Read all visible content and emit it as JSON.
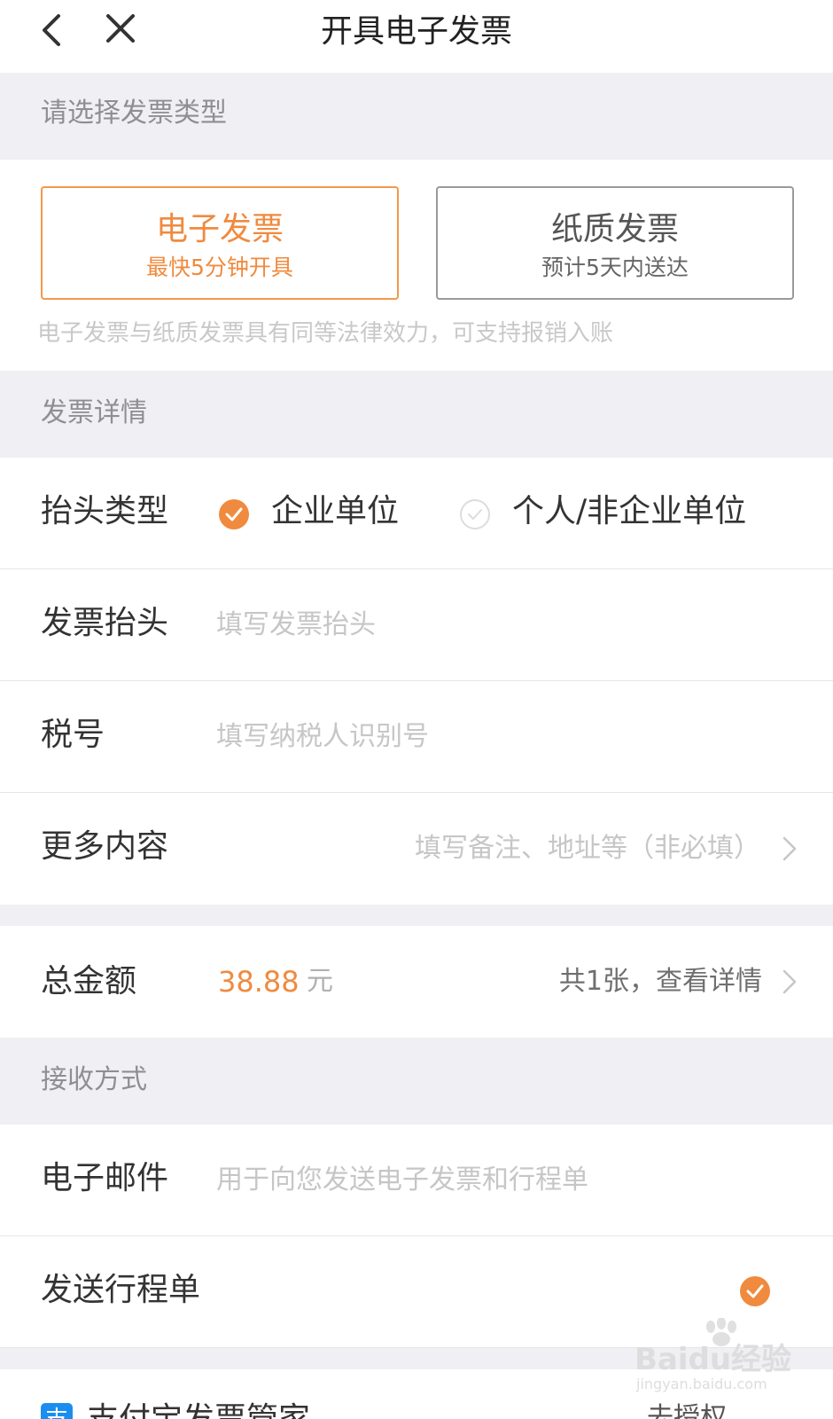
{
  "nav": {
    "title": "开具电子发票"
  },
  "section_type": {
    "header": "请选择发票类型",
    "options": [
      {
        "title": "电子发票",
        "subtitle": "最快5分钟开具",
        "selected": true
      },
      {
        "title": "纸质发票",
        "subtitle": "预计5天内送达",
        "selected": false
      }
    ],
    "note": "电子发票与纸质发票具有同等法律效力，可支持报销入账"
  },
  "section_detail": {
    "header": "发票详情",
    "title_type": {
      "label": "抬头类型",
      "options": [
        {
          "label": "企业单位",
          "checked": true
        },
        {
          "label": "个人/非企业单位",
          "checked": false
        }
      ]
    },
    "invoice_title": {
      "label": "发票抬头",
      "placeholder": "填写发票抬头"
    },
    "tax_number": {
      "label": "税号",
      "placeholder": "填写纳税人识别号"
    },
    "more": {
      "label": "更多内容",
      "hint": "填写备注、地址等（非必填）"
    }
  },
  "total": {
    "label": "总金额",
    "amount": "38.88",
    "unit": "元",
    "detail_link": "共1张，查看详情"
  },
  "section_receive": {
    "header": "接收方式",
    "email": {
      "label": "电子邮件",
      "placeholder": "用于向您发送电子发票和行程单"
    },
    "itinerary": {
      "label": "发送行程单",
      "checked": true
    }
  },
  "alipay": {
    "logo_char": "支",
    "label": "支付宝发票管家",
    "action": "去授权"
  },
  "watermark": {
    "brand": "Baidu经验",
    "url": "jingyan.baidu.com"
  },
  "colors": {
    "accent": "#f08a3e",
    "section_bg": "#efeff4",
    "placeholder": "#c6c6c6"
  }
}
